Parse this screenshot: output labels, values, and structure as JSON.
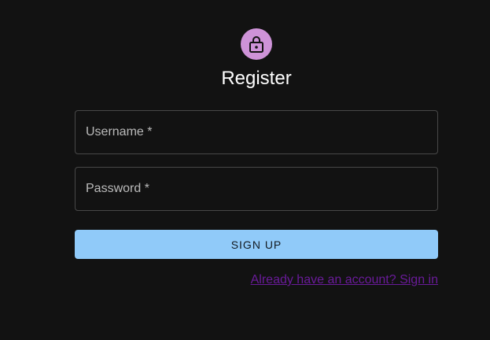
{
  "header": {
    "icon": "lock-icon",
    "title": "Register"
  },
  "form": {
    "username": {
      "label": "Username *",
      "value": ""
    },
    "password": {
      "label": "Password *",
      "value": ""
    },
    "submit_label": "SIGN UP",
    "signin_link": "Already have an account? Sign in"
  },
  "colors": {
    "background": "#121212",
    "avatar": "#ce93d8",
    "button": "#90caf9",
    "link": "#6a1b9a"
  }
}
